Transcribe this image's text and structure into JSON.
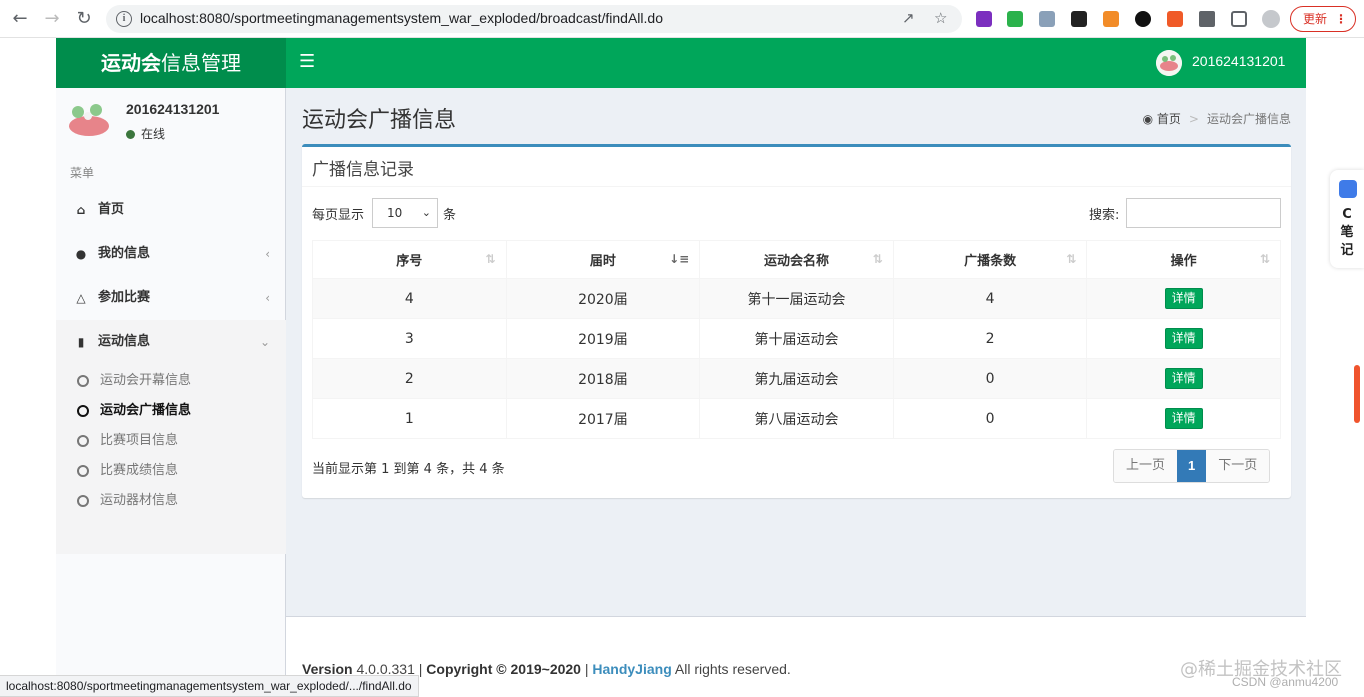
{
  "browser": {
    "url": "localhost:8080/sportmeetingmanagementsystem_war_exploded/broadcast/findAll.do",
    "update_label": "更新",
    "status_url": "localhost:8080/sportmeetingmanagementsystem_war_exploded/.../findAll.do"
  },
  "header": {
    "logo_bold": "运动会",
    "logo_rest": "信息管理",
    "user": "201624131201"
  },
  "sidebar": {
    "user": "201624131201",
    "status": "在线",
    "menu_header": "菜单",
    "items": [
      {
        "label": "首页",
        "icon": "home-icon"
      },
      {
        "label": "我的信息",
        "icon": "user-icon"
      },
      {
        "label": "参加比赛",
        "icon": "trophy-icon"
      },
      {
        "label": "运动信息",
        "icon": "bar-chart-icon"
      }
    ],
    "subitems": [
      {
        "label": "运动会开幕信息"
      },
      {
        "label": "运动会广播信息"
      },
      {
        "label": "比赛项目信息"
      },
      {
        "label": "比赛成绩信息"
      },
      {
        "label": "运动器材信息"
      }
    ]
  },
  "content": {
    "title": "运动会广播信息",
    "breadcrumb_home": "首页",
    "breadcrumb_current": "运动会广播信息",
    "box_title": "广播信息记录",
    "length_label": "每页显示",
    "length_value": "10",
    "length_unit": "条",
    "search_label": "搜索:",
    "search_value": "",
    "table": {
      "headers": [
        "序号",
        "届时",
        "运动会名称",
        "广播条数",
        "操作"
      ],
      "rows": [
        {
          "no": "4",
          "session": "2020届",
          "name": "第十一届运动会",
          "count": "4",
          "action": "详情"
        },
        {
          "no": "3",
          "session": "2019届",
          "name": "第十届运动会",
          "count": "2",
          "action": "详情"
        },
        {
          "no": "2",
          "session": "2018届",
          "name": "第九届运动会",
          "count": "0",
          "action": "详情"
        },
        {
          "no": "1",
          "session": "2017届",
          "name": "第八届运动会",
          "count": "0",
          "action": "详情"
        }
      ]
    },
    "info": "当前显示第 1 到第 4 条，共 4 条",
    "pager": {
      "prev": "上一页",
      "current": "1",
      "next": "下一页"
    }
  },
  "footer": {
    "version_label": "Version",
    "version": "4.0.0.331",
    "copyright": "Copyright © 2019~2020",
    "author": "HandyJiang",
    "rights": "All rights reserved."
  },
  "dock": {
    "text": "C笔记"
  },
  "watermark": {
    "main": "@稀土掘金技术社区",
    "sub": "CSDN @anmu4200"
  },
  "colors": {
    "brand_green": "#00a65a",
    "box_accent": "#3c8dbc",
    "pager_active": "#337ab7"
  }
}
